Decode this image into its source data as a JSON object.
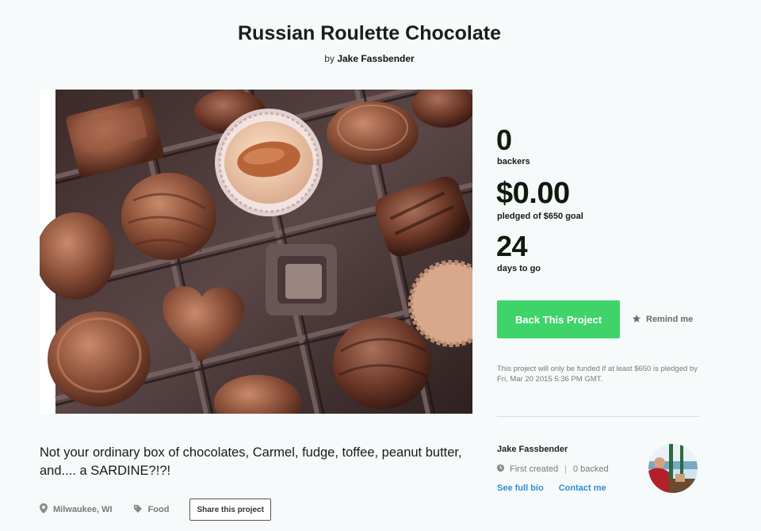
{
  "project": {
    "title": "Russian Roulette Chocolate",
    "by_prefix": "by",
    "creator": "Jake Fassbender",
    "blurb": "Not your ordinary box of chocolates, Carmel, fudge, toffee, peanut butter, and.... a SARDINE?!?!",
    "image_alt": "Box of assorted chocolates"
  },
  "stats": {
    "backers_value": "0",
    "backers_label": "backers",
    "pledged_value": "$0.00",
    "pledged_label": "pledged of $650 goal",
    "days_value": "24",
    "days_label": "days to go"
  },
  "actions": {
    "back_label": "Back This Project",
    "remind_label": "Remind me",
    "funding_note": "This project will only be funded if at least $650 is pledged by Fri, Mar 20 2015 5:36 PM GMT."
  },
  "meta": {
    "location": "Milwaukee, WI",
    "category": "Food",
    "share_label": "Share this project"
  },
  "creator_card": {
    "name": "Jake Fassbender",
    "first_created": "First created",
    "separator": "|",
    "backed": "0 backed",
    "bio_link": "See full bio",
    "contact_link": "Contact me"
  },
  "icons": {
    "location": "map-pin-icon",
    "category": "tag-icon",
    "remind": "star-icon",
    "first_created": "clock-icon"
  },
  "colors": {
    "accent_green": "#3fd46a",
    "link_blue": "#2b8fd6",
    "background": "#f7fafa"
  }
}
